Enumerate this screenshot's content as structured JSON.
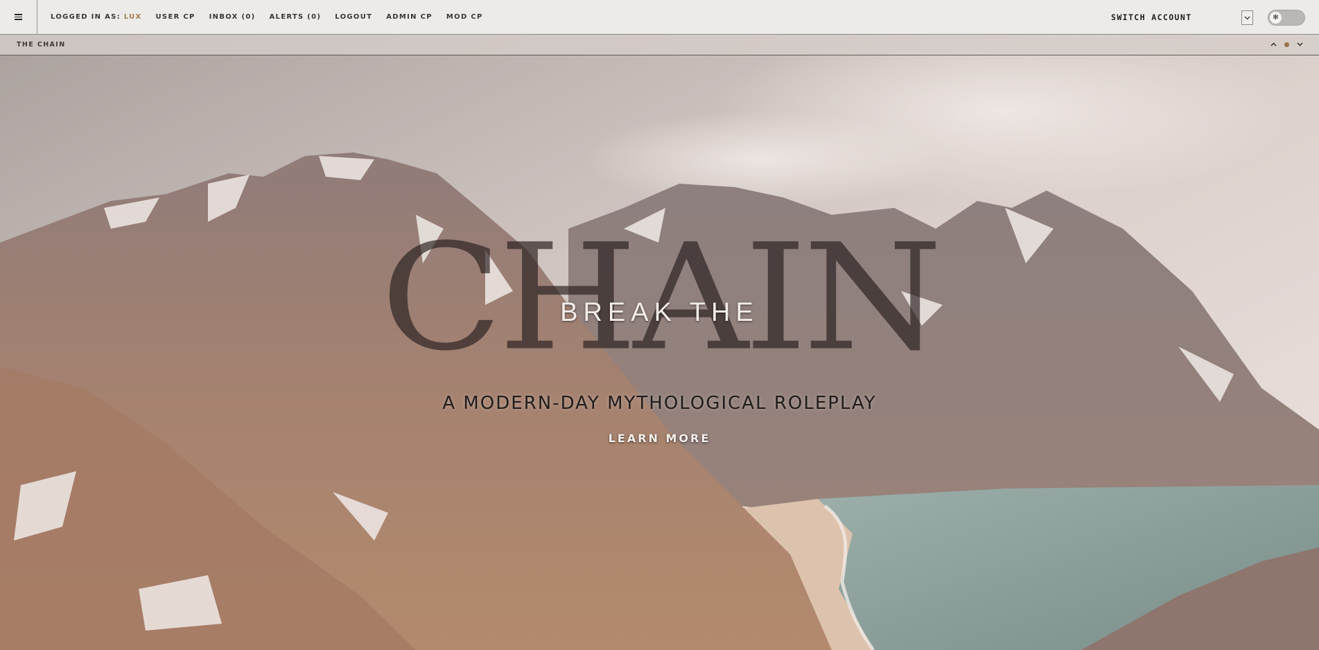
{
  "nav": {
    "logged_in_label": "LOGGED IN AS:",
    "username": "LUX",
    "links": [
      "USER CP",
      "INBOX (0)",
      "ALERTS (0)",
      "LOGOUT",
      "ADMIN CP",
      "MOD CP"
    ],
    "switch_account": "SWITCH ACCOUNT",
    "menu_icon": "hamburger-icon",
    "theme_icon": "sun-icon"
  },
  "subbar": {
    "title": "THE CHAIN"
  },
  "hero": {
    "background_title": "CHAIN",
    "title": "BREAK THE",
    "tagline": "A MODERN-DAY MYTHOLOGICAL ROLEPLAY",
    "cta": "LEARN MORE"
  },
  "colors": {
    "accent": "#a47b4f",
    "topbar_bg": "#ecebe9",
    "overlay_text": "#2a2020"
  }
}
